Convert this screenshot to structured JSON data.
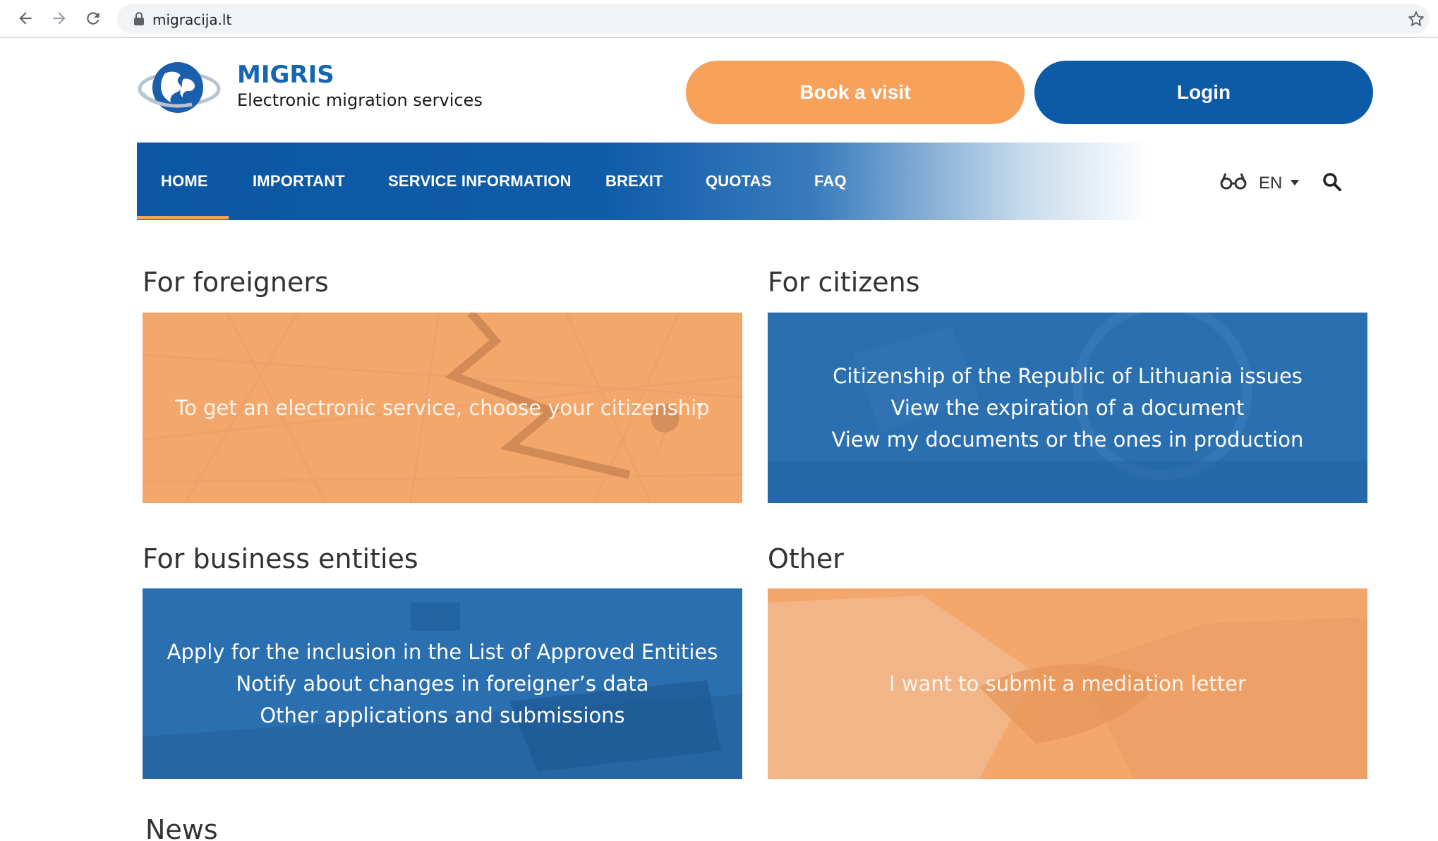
{
  "browser": {
    "url": "migracija.lt",
    "icons": [
      "back-icon",
      "forward-icon",
      "reload-icon",
      "lock-icon",
      "star-icon"
    ]
  },
  "header": {
    "brand_title": "MIGRIS",
    "brand_subtitle": "Electronic migration services",
    "book_label": "Book a visit",
    "login_label": "Login"
  },
  "nav": {
    "items": [
      {
        "label": "HOME",
        "active": true
      },
      {
        "label": "IMPORTANT"
      },
      {
        "label": "SERVICE INFORMATION"
      },
      {
        "label": "BREXIT"
      },
      {
        "label": "QUOTAS"
      },
      {
        "label": "FAQ"
      }
    ],
    "language": "EN",
    "icons": [
      "glasses-icon",
      "chevron-down-icon",
      "search-icon"
    ]
  },
  "sections": {
    "foreigners": {
      "title": "For foreigners",
      "lines": [
        "To get an electronic service, choose your citizenship"
      ]
    },
    "citizens": {
      "title": "For citizens",
      "lines": [
        "Citizenship of the Republic of Lithuania issues",
        "View the expiration of a document",
        "View my documents or the ones in production"
      ]
    },
    "business": {
      "title": "For business entities",
      "lines": [
        "Apply for the inclusion in the List of Approved Entities",
        "Notify about changes in foreigner’s data",
        "Other applications and submissions"
      ]
    },
    "other": {
      "title": "Other",
      "lines": [
        "I want to submit a mediation letter"
      ]
    },
    "news": {
      "title": "News"
    }
  },
  "colors": {
    "brand_blue": "#0d5aa7",
    "accent_orange": "#f7a25b",
    "card_blue": "#2a6fb0",
    "card_orange": "#f4a76b"
  }
}
